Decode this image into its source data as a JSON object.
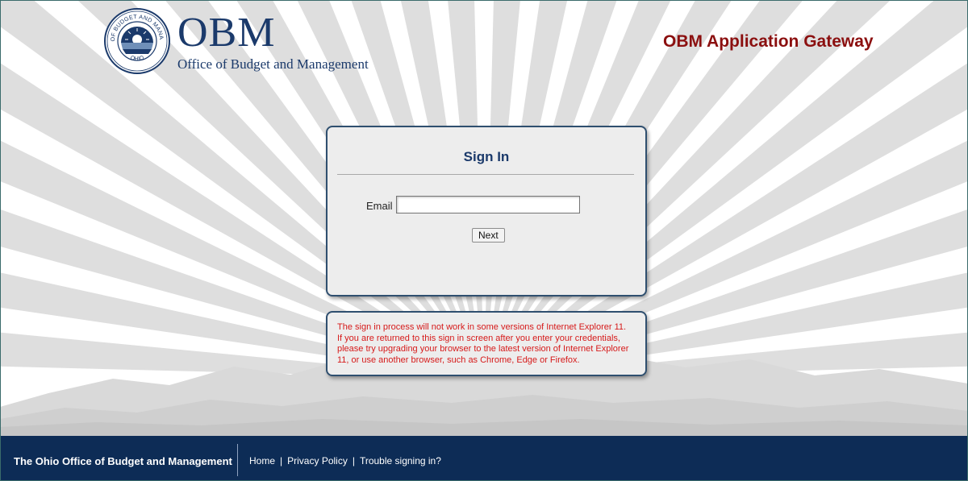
{
  "header": {
    "logo": {
      "wordmark": "OBM",
      "subtitle": "Office of Budget and Management",
      "seal_text": "OFFICE OF BUDGET AND MANAGEMENT",
      "seal_state": "OHIO"
    },
    "app_title": "OBM Application Gateway"
  },
  "signin": {
    "title": "Sign In",
    "email_label": "Email",
    "email_value": "",
    "next_label": "Next"
  },
  "notice": {
    "lines": [
      "The sign in process will not work in some versions of Internet Explorer 11.",
      "If you are returned to this sign in screen after you enter your credentials,",
      "please try upgrading your browser to the latest version of Internet Explorer",
      "11, or use another browser, such as Chrome, Edge or Firefox."
    ]
  },
  "footer": {
    "org": "The Ohio Office of Budget and Management",
    "links": [
      "Home",
      "Privacy Policy",
      "Trouble signing in?"
    ],
    "separator": "|"
  },
  "colors": {
    "brand_navy": "#1b3a6b",
    "title_red": "#8b0f0f",
    "notice_red": "#d61a1a",
    "footer_bg": "#0d2c56",
    "card_bg": "#ededed",
    "card_border": "#2f4f6f"
  },
  "icons": {
    "seal": "ohio-state-seal-icon",
    "background": "sunburst-mountains-graphic"
  }
}
